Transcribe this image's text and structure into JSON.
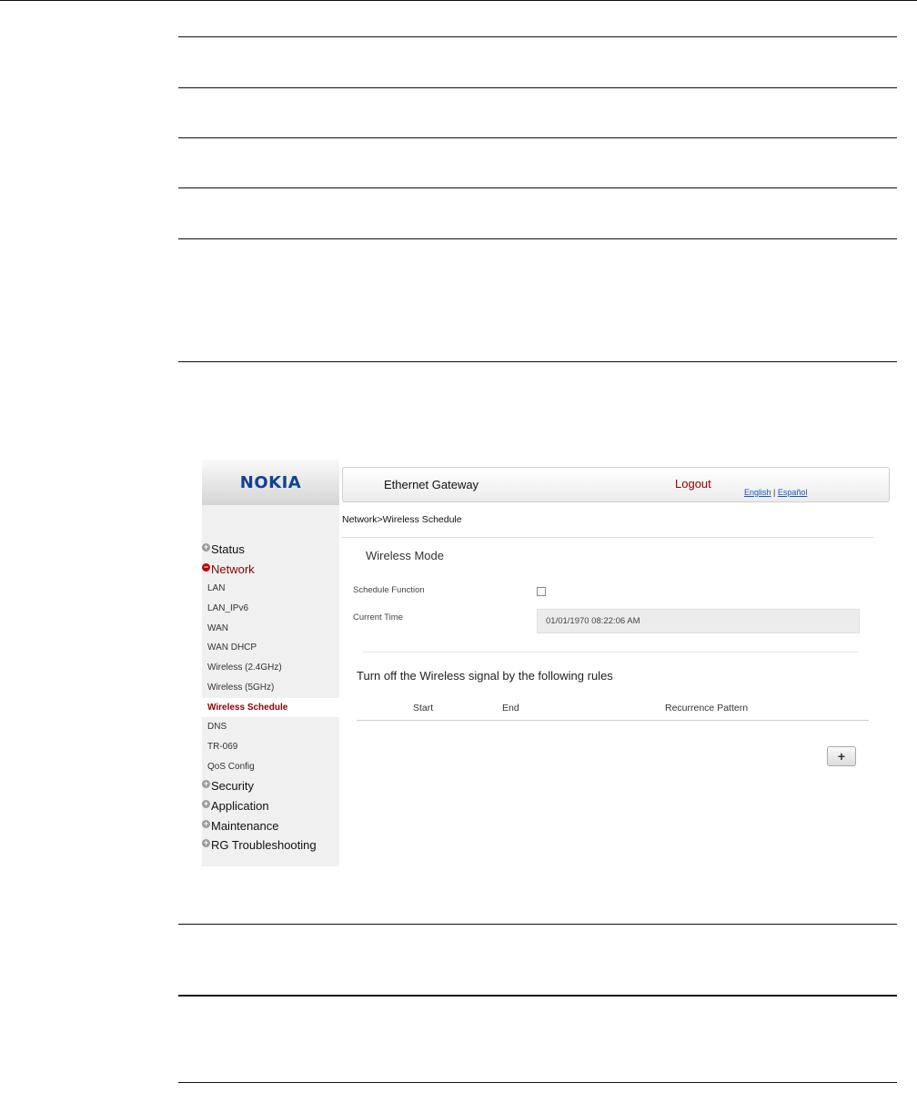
{
  "app": {
    "brand": "NOKIA",
    "title": "Ethernet Gateway",
    "logout_label": "Logout",
    "lang_english": "English",
    "lang_separator": " | ",
    "lang_espanol": "Español",
    "brand_color": "#124191",
    "accent_color": "#8b0000"
  },
  "breadcrumb": "Network>Wireless Schedule",
  "sidebar": {
    "status": "Status",
    "network": "Network",
    "network_items": [
      "LAN",
      "LAN_IPv6",
      "WAN",
      "WAN DHCP",
      "Wireless (2.4GHz)",
      "Wireless (5GHz)",
      "Wireless Schedule",
      "DNS",
      "TR-069",
      "QoS Config"
    ],
    "active_item": "Wireless Schedule",
    "security": "Security",
    "application": "Application",
    "maintenance": "Maintenance",
    "troubleshooting": "RG Troubleshooting",
    "expand_icon": "plus-circle-icon",
    "collapse_icon": "minus-circle-icon"
  },
  "wireless_mode": {
    "title": "Wireless Mode",
    "schedule_label": "Schedule Function",
    "schedule_checked": false,
    "time_label": "Current Time",
    "time_value": "01/01/1970 08:22:06 AM"
  },
  "rules": {
    "title": "Turn off the Wireless signal by the following rules",
    "columns": [
      "Start",
      "End",
      "Recurrence Pattern"
    ],
    "add_label": "+"
  }
}
